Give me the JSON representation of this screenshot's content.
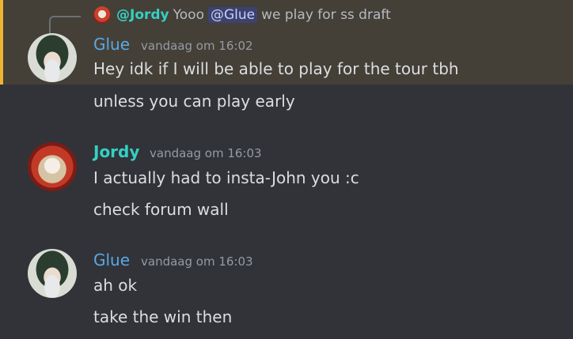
{
  "reply": {
    "author": "@Jordy",
    "text_before": "Yooo",
    "mention": "@Glue",
    "text_after": "we play for ss draft"
  },
  "messages": [
    {
      "author": "Glue",
      "timestamp": "vandaag om 16:02",
      "lines": [
        "Hey idk if I will be able to play for the tour tbh",
        "unless you can play early"
      ]
    },
    {
      "author": "Jordy",
      "timestamp": "vandaag om 16:03",
      "lines": [
        "I actually had to insta-John you :c",
        "check forum wall"
      ]
    },
    {
      "author": "Glue",
      "timestamp": "vandaag om 16:03",
      "lines": [
        "ah ok",
        "take the win then"
      ]
    }
  ],
  "colors": {
    "background": "#313338",
    "highlight": "#444037",
    "highlight_bar": "#f0b232",
    "glue_name": "#5aa9e6",
    "jordy_name": "#35d0c3",
    "mention_bg": "#3c4270"
  }
}
